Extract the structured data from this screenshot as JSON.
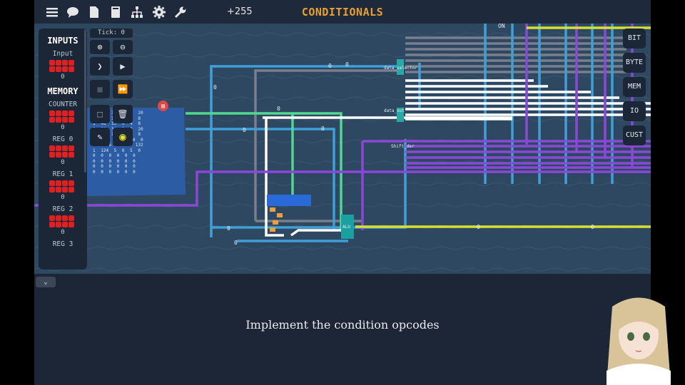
{
  "topbar": {
    "title": "CONDITIONALS",
    "coins": "+255",
    "icons": [
      "menu-icon",
      "chat-icon",
      "document-icon",
      "book-icon",
      "hierarchy-icon",
      "gear-icon",
      "wrench-icon"
    ]
  },
  "sidebar": {
    "inputs_header": "INPUTS",
    "input_label": "Input",
    "input_value": "0",
    "memory_header": "MEMORY",
    "registers": [
      {
        "label": "COUNTER",
        "value": "0"
      },
      {
        "label": "REG 0",
        "value": "0"
      },
      {
        "label": "REG 1",
        "value": "0"
      },
      {
        "label": "REG 2",
        "value": "0"
      },
      {
        "label": "REG 3",
        "value": ""
      }
    ]
  },
  "toolbar": {
    "tick": "Tick: 0",
    "zoom_in": "⊕",
    "zoom_out": "⊖",
    "step": "❯",
    "play": "▶",
    "stop": "■",
    "fast_forward": "⏩",
    "select": "⬚",
    "delete": "🗑",
    "pencil": "✎",
    "ring": "◉"
  },
  "categories": [
    "BIT",
    "BYTE",
    "MEM",
    "IO",
    "CUST"
  ],
  "program_rows": [
    "1 10 32 2 0 20",
    "0 32 15 0 0 8",
    "1 48 15 0 4 8",
    "1 64 34 1 0 20",
    "2 90 15 0 4 8",
    "2 112 15 0 4 0",
    "0 5 6 37 0 132",
    "1 124 5 0 5 0",
    "0 0 0 0 0 0",
    "0 0 0 0 0 0",
    "0 0 0 0 0 0",
    "0 0 0 0 0 0"
  ],
  "labels": {
    "on": "ON",
    "data_selector": "data_selector",
    "data_out": "data_out",
    "shift": "Shift_der",
    "alu": "ALU",
    "wire_zero": "0"
  },
  "dock": {
    "collapse": "⌄",
    "instruction": "Implement the condition opcodes"
  },
  "colors": {
    "wire_gray": "#707a86",
    "wire_blue": "#3fa0d8",
    "wire_white": "#ffffff",
    "wire_purple": "#8b48d8",
    "wire_yellow": "#d8e030",
    "wire_green": "#50d890",
    "accent_title": "#e8a030"
  }
}
